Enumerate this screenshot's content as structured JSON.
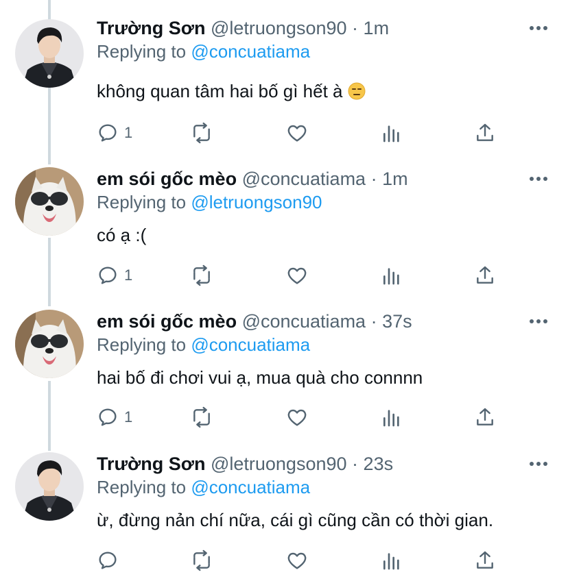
{
  "tweets": [
    {
      "name": "Trường Sơn",
      "handle": "@letruongson90",
      "time": "1m",
      "replying_prefix": "Replying to",
      "replying_to": "@concuatiama",
      "text": "không quan tâm hai bố gì hết à",
      "emoji": "expressionless-face-emoji",
      "reply_count": "1",
      "avatar": "man-avatar"
    },
    {
      "name": "em sói gốc mèo",
      "handle": "@concuatiama",
      "time": "1m",
      "replying_prefix": "Replying to",
      "replying_to": "@letruongson90",
      "text": "có ạ :(",
      "reply_count": "1",
      "avatar": "dog-avatar"
    },
    {
      "name": "em sói gốc mèo",
      "handle": "@concuatiama",
      "time": "37s",
      "replying_prefix": "Replying to",
      "replying_to": "@concuatiama",
      "text": "hai bố đi chơi vui ạ, mua quà cho connnn",
      "reply_count": "1",
      "avatar": "dog-avatar"
    },
    {
      "name": "Trường Sơn",
      "handle": "@letruongson90",
      "time": "23s",
      "replying_prefix": "Replying to",
      "replying_to": "@concuatiama",
      "text": "ừ, đừng nản chí nữa, cái gì cũng cần có thời gian.",
      "reply_count": "",
      "avatar": "man-avatar"
    }
  ],
  "separator": "·",
  "colors": {
    "accent": "#1d9bf0",
    "secondary": "#536471",
    "text": "#0f1419",
    "thread_line": "#cfd9de"
  }
}
